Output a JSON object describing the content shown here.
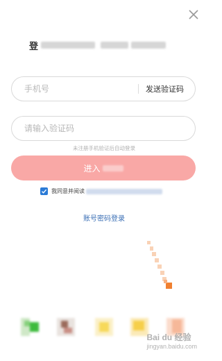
{
  "header": {
    "title_prefix": "登"
  },
  "form": {
    "phone_placeholder": "手机号",
    "send_code_label": "发送验证码",
    "code_placeholder": "请输入验证码",
    "hint_text": "未注册手机验证后自动登录",
    "login_button_label": "进入"
  },
  "agreement": {
    "checked": true,
    "text": "我同意并阅读"
  },
  "alt_login": {
    "label": "账号密码登录"
  },
  "social_icons": [
    "wechat-icon",
    "avatar-icon",
    "yellow-app-icon",
    "yellow-app-icon-2",
    "peach-app-icon"
  ],
  "colors": {
    "primary_button": "#f9a8a6",
    "checkbox": "#2b7bd6",
    "link": "#3b6fb5",
    "annotation_arrow": "#f08030"
  },
  "watermark": {
    "text": "Bai du 经验",
    "sub": "jingyan.baidu.com"
  }
}
